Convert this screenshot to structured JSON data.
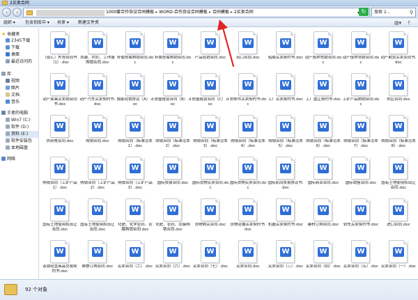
{
  "window": {
    "title": "2买卖合同"
  },
  "address": {
    "crumbs": [
      "1000套合作协议合同模板",
      "WORD-合作协议合同模板",
      "合同模板",
      "2买卖合同"
    ],
    "search_placeholder": "搜索 2..."
  },
  "toolbar": {
    "organize": "组织 ▾",
    "include": "包含到库中 ▾",
    "share": "共享 ▾",
    "new_folder": "新建文件夹"
  },
  "sidebar": {
    "favorites_label": "收藏夹",
    "favorites": [
      "2345下载",
      "下载",
      "桌面",
      "最近访问的"
    ],
    "library_label": "库",
    "library": [
      "视频",
      "图片",
      "文档",
      "音乐"
    ],
    "computer_label": "王者的电脑",
    "drives": [
      "Win7 (C:)",
      "软件 (D:)",
      "资料 (E:)",
      "软件安装包",
      "本地磁盘"
    ],
    "network_label": "网络"
  },
  "files": [
    "（现汇）外贸合同书（1）.doc",
    "西装、衬衫、工作服购销合同.doc",
    "补偿贸易购销合同.doc",
    "补偿贸易购销合同.doc",
    "产品经销合同.doc",
    "出口合同.doc",
    "船舶买卖契约书.doc",
    "动产抵押贷款合同.doc",
    "动产抵押贷款合同.doc",
    "动产期货买卖合同书.doc",
    "动产家具买卖销合同书.doc",
    "动产汽车买卖契约书.doc",
    "独家经销协议（A）.doc",
    "房屋租赁合同（B）.doc",
    "房屋租赁合同（C）.doc",
    "附条件买卖契约书.doc",
    "工厂买卖契约书.doc",
    "工厂盘让契约书.doc",
    "工矿产品购销合同.doc",
    "供应合同.doc",
    "供用电合同.doc",
    "购销合同.doc",
    "购销合同（标准范本1）.doc",
    "购销合同（标准范本2）.doc",
    "购销合同（标准范本3）.doc",
    "购销合同（标准范本4）.doc",
    "购销合同（标准范本5）.doc",
    "购销合同（标准范本6）.doc",
    "购销合同（标准范本7）.doc",
    "购销合同（标准范本8）.doc",
    "购销合同（工矿产品1）.doc",
    "购销合同（工矿产品2）.doc",
    "购销合同（工矿产品3）.doc",
    "国际贸易合同.doc",
    "国际货物买卖合同.doc",
    "国际货物买卖合同.doc",
    "国际民间贸易协议书.doc",
    "国际商业合同.doc",
    "国际销售合同.doc",
    "国有土地使用权出让合同.doc",
    "国有土地使用权出让合同.doc",
    "国有土地使用权出让合同.doc",
    "化肥、化学农药、农膜购销合同.doc",
    "化肥、农药、农膜购销合同.doc",
    "货物购买合同.doc",
    "货物运输买卖契约书.doc",
    "机器买卖契约书.doc",
    "建材订购合同.doc",
    "轿车买卖契约书.doc",
    "进口合同.doc",
    "连锁经营商品交易契约书.doc",
    "粮食订购合同.doc",
    "买卖合同（二）.doc",
    "买卖合同（六）.doc",
    "买卖合同（七）.doc",
    "买卖合同.doc",
    "买卖合同（三）.doc",
    "买卖合同（四）.doc",
    "买卖合同（五）.doc",
    "买卖合同（一）.doc"
  ],
  "status": {
    "count": "92 个对象"
  }
}
